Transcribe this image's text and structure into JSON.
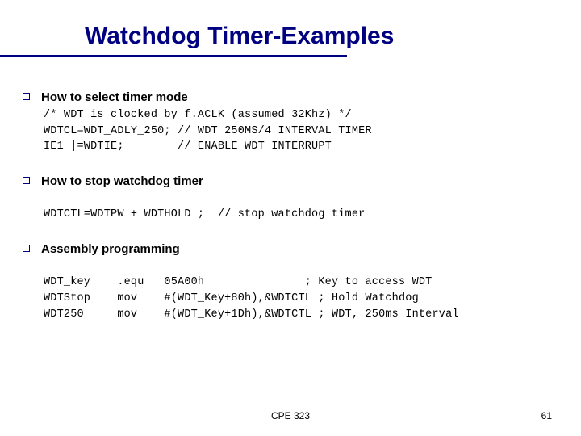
{
  "title": "Watchdog Timer-Examples",
  "sections": [
    {
      "heading": "How to select timer mode",
      "code": "/* WDT is clocked by f.ACLK (assumed 32Khz) */\nWDTCL=WDT_ADLY_250; // WDT 250MS/4 INTERVAL TIMER\nIE1 |=WDTIE;        // ENABLE WDT INTERRUPT"
    },
    {
      "heading": "How to stop watchdog timer",
      "code": "\nWDTCTL=WDTPW + WDTHOLD ;  // stop watchdog timer"
    },
    {
      "heading": "Assembly programming",
      "code": "\nWDT_key    .equ   05A00h               ; Key to access WDT\nWDTStop    mov    #(WDT_Key+80h),&WDTCTL ; Hold Watchdog\nWDT250     mov    #(WDT_Key+1Dh),&WDTCTL ; WDT, 250ms Interval"
    }
  ],
  "footer": {
    "center": "CPE 323",
    "page": "61"
  }
}
